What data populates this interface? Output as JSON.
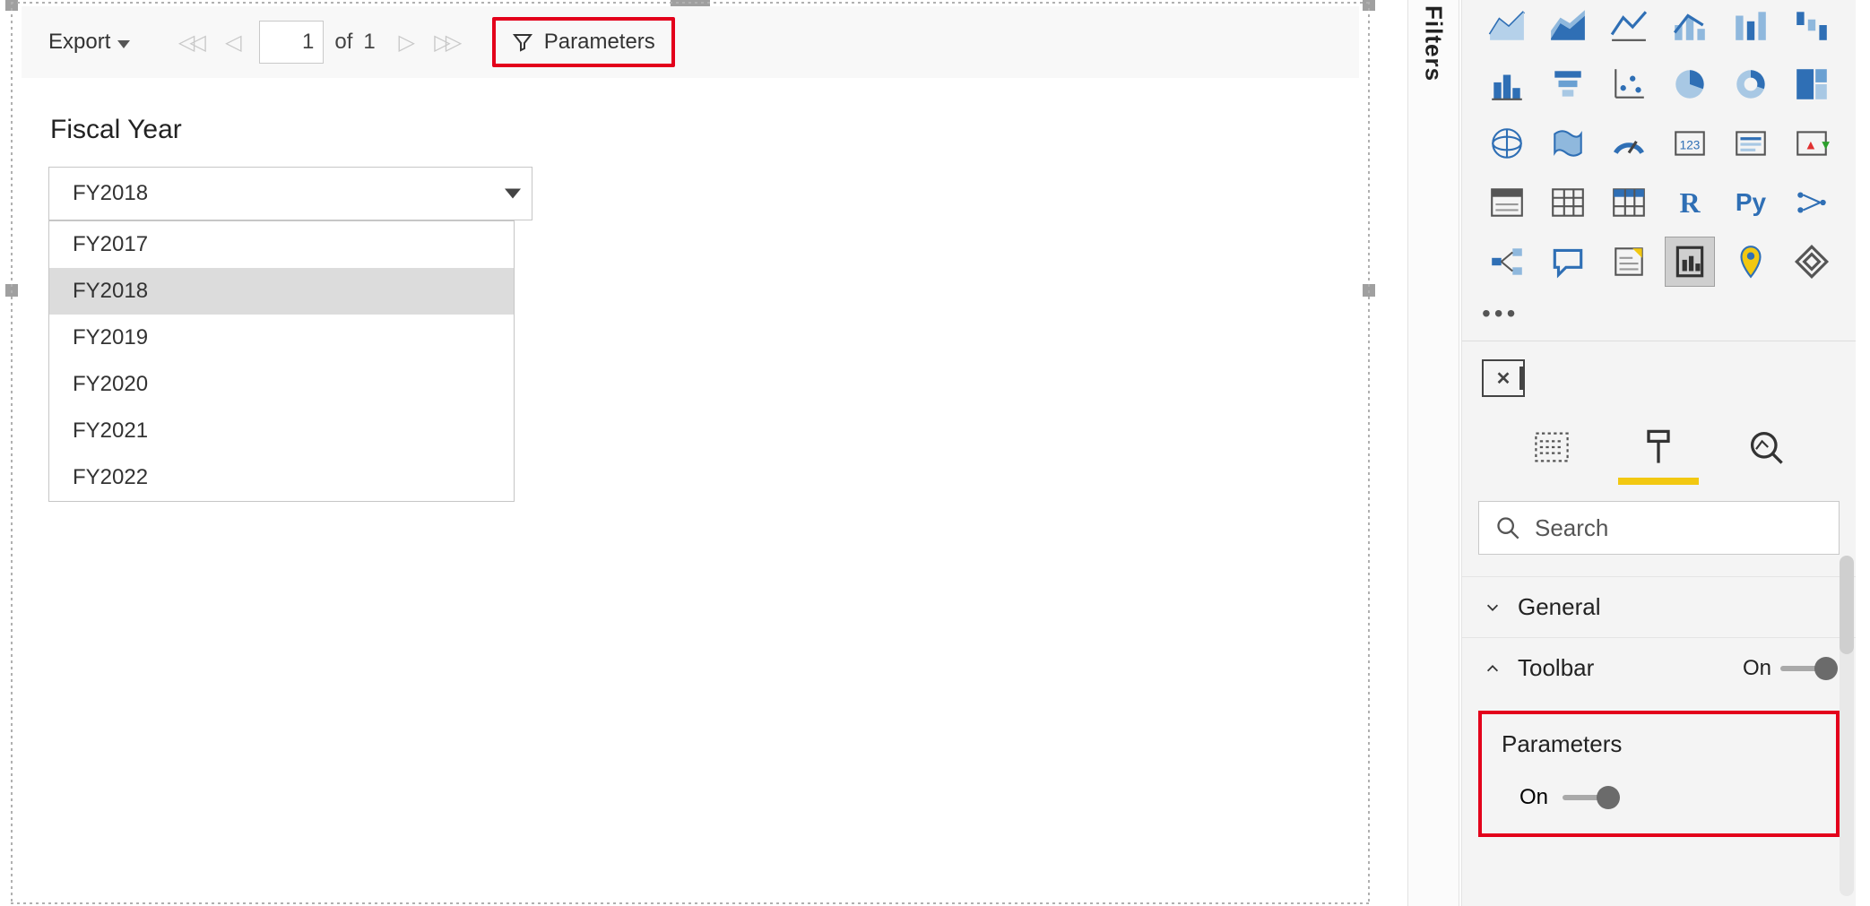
{
  "toolbar": {
    "export_label": "Export",
    "current_page": "1",
    "of_label": "of",
    "total_pages": "1",
    "parameters_label": "Parameters"
  },
  "report": {
    "section_title": "Fiscal Year",
    "selected_value": "FY2018",
    "options": [
      {
        "label": "FY2017",
        "selected": false
      },
      {
        "label": "FY2018",
        "selected": true
      },
      {
        "label": "FY2019",
        "selected": false
      },
      {
        "label": "FY2020",
        "selected": false
      },
      {
        "label": "FY2021",
        "selected": false
      },
      {
        "label": "FY2022",
        "selected": false
      }
    ]
  },
  "filters_pane": {
    "label": "Filters"
  },
  "format_pane": {
    "search_placeholder": "Search",
    "sections": {
      "general": {
        "label": "General"
      },
      "toolbar": {
        "label": "Toolbar",
        "state": "On"
      },
      "parameters": {
        "label": "Parameters",
        "state": "On"
      }
    },
    "r_label": "R",
    "py_label": "Py",
    "num_label": "123",
    "remove_label": "✕"
  }
}
